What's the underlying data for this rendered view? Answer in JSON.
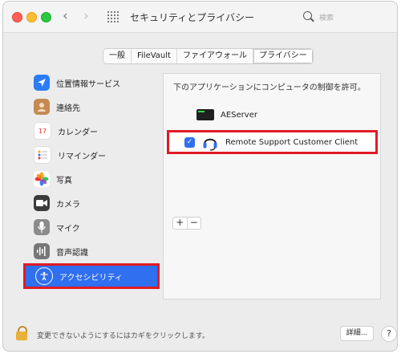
{
  "window": {
    "title": "セキュリティとプライバシー",
    "search_placeholder": "検索",
    "nav_back": "‹",
    "nav_forward": "›"
  },
  "tabs": [
    {
      "label": "一般"
    },
    {
      "label": "FileVault"
    },
    {
      "label": "ファイアウォール"
    },
    {
      "label": "プライバシー",
      "active": true
    }
  ],
  "sidebar": {
    "items": [
      {
        "label": "位置情報サービス",
        "icon": "location-icon"
      },
      {
        "label": "連絡先",
        "icon": "contacts-icon"
      },
      {
        "label": "カレンダー",
        "icon": "calendar-icon",
        "icon_text": "17"
      },
      {
        "label": "リマインダー",
        "icon": "reminders-icon"
      },
      {
        "label": "写真",
        "icon": "photos-icon"
      },
      {
        "label": "カメラ",
        "icon": "camera-icon"
      },
      {
        "label": "マイク",
        "icon": "microphone-icon"
      },
      {
        "label": "音声認識",
        "icon": "speech-recognition-icon"
      },
      {
        "label": "アクセシビリティ",
        "icon": "accessibility-icon",
        "selected": true
      }
    ]
  },
  "panel": {
    "title": "下のアプリケーションにコンピュータの制御を許可。",
    "apps": [
      {
        "name": "AEServer",
        "checked": false
      },
      {
        "name": "Remote Support Customer Client",
        "checked": true
      }
    ],
    "add_label": "+",
    "remove_label": "−"
  },
  "footer": {
    "lock_text": "変更できないようにするにはカギをクリックします。",
    "advanced_label": "詳細...",
    "help_label": "?"
  },
  "colors": {
    "accent": "#2f6ff0",
    "highlight": "#e01b24"
  }
}
